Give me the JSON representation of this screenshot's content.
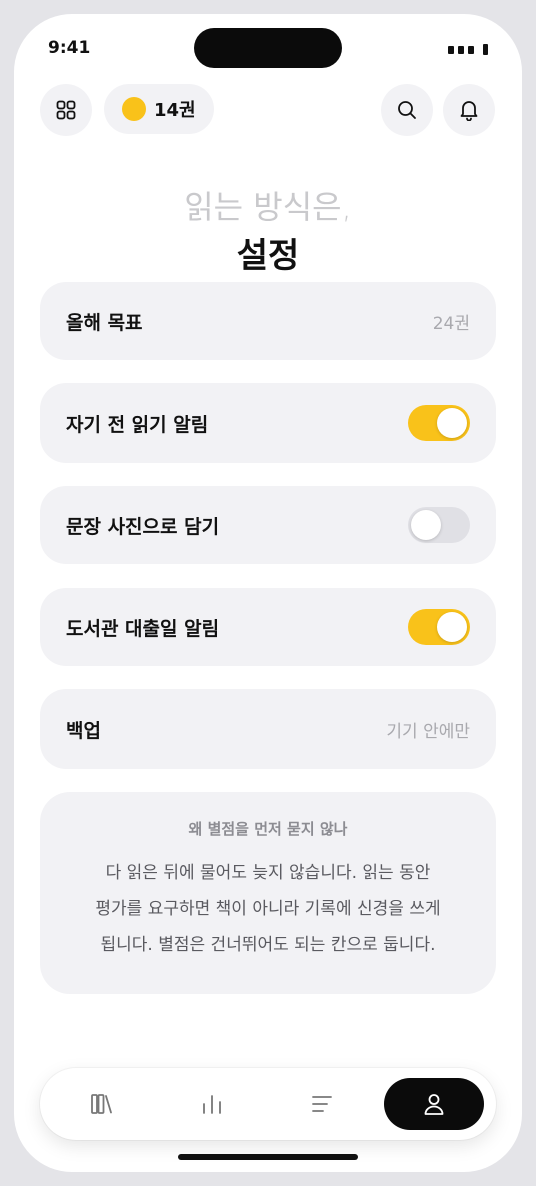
{
  "status": {
    "time": "9:41"
  },
  "header": {
    "book_count": "14권"
  },
  "heading": {
    "sub": "읽는 방식은,",
    "main": "설정"
  },
  "settings": [
    {
      "label": "올해 목표",
      "value": "24권"
    },
    {
      "label": "자기 전 읽기 알림",
      "toggle": "on"
    },
    {
      "label": "문장 사진으로 담기",
      "toggle": "off"
    },
    {
      "label": "도서관 대출일 알림",
      "toggle": "on"
    },
    {
      "label": "백업",
      "value": "기기 안에만"
    }
  ],
  "note": {
    "title": "왜 별점을 먼저 묻지 않나",
    "line1": "다 읽은 뒤에 물어도 늦지 않습니다. 읽는 동안",
    "line2": "평가를 요구하면 책이 아니라 기록에 신경을 쓰게",
    "line3": "됩니다. 별점은 건너뛰어도 되는 칸으로 둡니다."
  },
  "colors": {
    "accent": "#f9c21a",
    "card_bg": "#f2f2f5",
    "active_tab": "#0b0b0b"
  },
  "icons": {
    "menu": "grid-icon",
    "coin": "coin-icon",
    "search": "search-icon",
    "bell": "bell-icon",
    "tabs": [
      "library-icon",
      "stats-icon",
      "list-icon",
      "profile-icon"
    ]
  },
  "tabbar": {
    "active_index": 3
  }
}
